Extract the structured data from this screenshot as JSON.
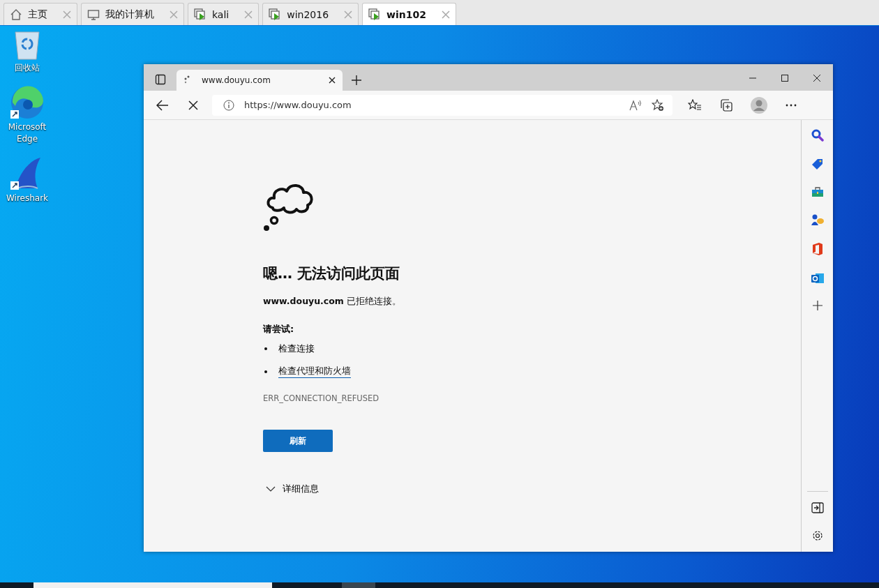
{
  "vm_tabs": [
    {
      "label": "主页",
      "selected": false
    },
    {
      "label": "我的计算机",
      "selected": false
    },
    {
      "label": "kali",
      "selected": false
    },
    {
      "label": "win2016",
      "selected": false
    },
    {
      "label": "win102",
      "selected": true
    }
  ],
  "desktop_icons": [
    {
      "label": "回收站"
    },
    {
      "label": "Microsoft Edge"
    },
    {
      "label": "Wireshark"
    }
  ],
  "browser": {
    "tab": {
      "title": "www.douyu.com"
    },
    "address": "https://www.douyu.com",
    "error": {
      "heading": "嗯… 无法访问此页面",
      "message": "**www.douyu.com** 已拒绝连接。",
      "try_label": "请尝试:",
      "suggestions": [
        {
          "kind": "text",
          "label": "检查连接"
        },
        {
          "kind": "link",
          "label": "检查代理和防火墙"
        }
      ],
      "code": "ERR_CONNECTION_REFUSED",
      "refresh_button": "刷新",
      "details": "详细信息"
    }
  }
}
